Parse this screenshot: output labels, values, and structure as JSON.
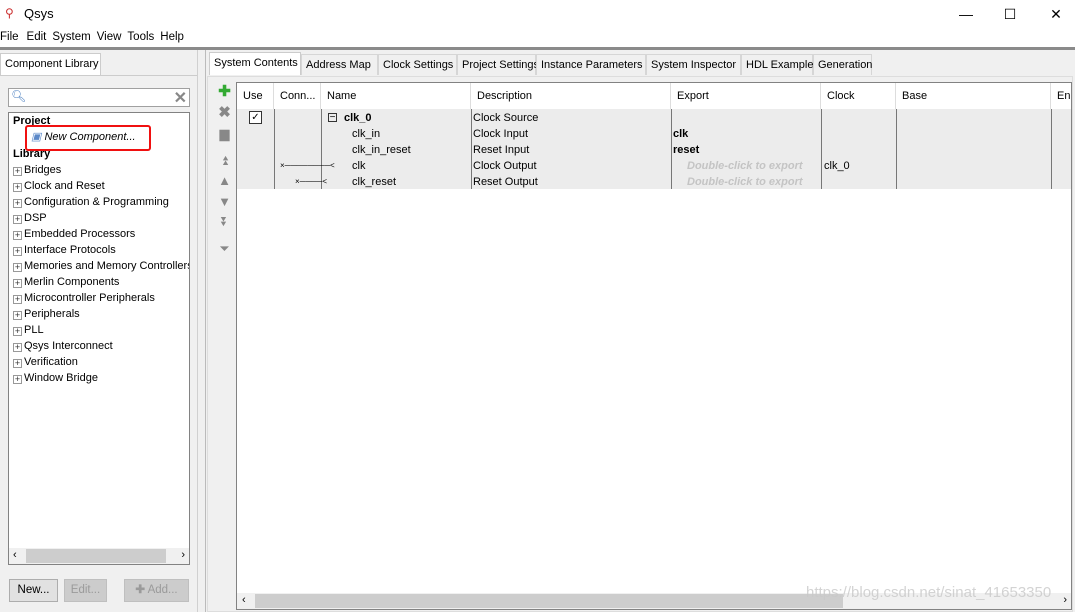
{
  "window": {
    "title": "Qsys",
    "controls": [
      "minimize",
      "maximize",
      "close"
    ]
  },
  "menu": [
    "File",
    "Edit",
    "System",
    "View",
    "Tools",
    "Help"
  ],
  "left": {
    "tab": "Component Library",
    "search": {
      "value": "",
      "placeholder": ""
    },
    "project_label": "Project",
    "new_component": "New Component...",
    "library_label": "Library",
    "items": [
      "Bridges",
      "Clock and Reset",
      "Configuration & Programming",
      "DSP",
      "Embedded Processors",
      "Interface Protocols",
      "Memories and Memory Controllers",
      "Merlin Components",
      "Microcontroller Peripherals",
      "Peripherals",
      "PLL",
      "Qsys Interconnect",
      "Verification",
      "Window Bridge"
    ],
    "buttons": {
      "new": "New...",
      "edit": "Edit...",
      "add": "Add..."
    }
  },
  "tabs": [
    "System Contents",
    "Address Map",
    "Clock Settings",
    "Project Settings",
    "Instance Parameters",
    "System Inspector",
    "HDL Example",
    "Generation"
  ],
  "table": {
    "headers": [
      "Use",
      "Conn...",
      "Name",
      "Description",
      "Export",
      "Clock",
      "Base",
      "End"
    ],
    "rows": [
      {
        "name": "clk_0",
        "description": "Clock Source",
        "export": "",
        "clock": "",
        "use": true,
        "expanded": true
      },
      {
        "name": "clk_in",
        "description": "Clock Input",
        "export": "clk",
        "clock": ""
      },
      {
        "name": "clk_in_reset",
        "description": "Reset Input",
        "export": "reset",
        "clock": ""
      },
      {
        "name": "clk",
        "description": "Clock Output",
        "export": "Double-click to export",
        "clock": "clk_0"
      },
      {
        "name": "clk_reset",
        "description": "Reset Output",
        "export": "Double-click to export",
        "clock": ""
      }
    ]
  },
  "watermark": "https://blog.csdn.net/sinat_41653350",
  "highlight_color": "#ff0000"
}
